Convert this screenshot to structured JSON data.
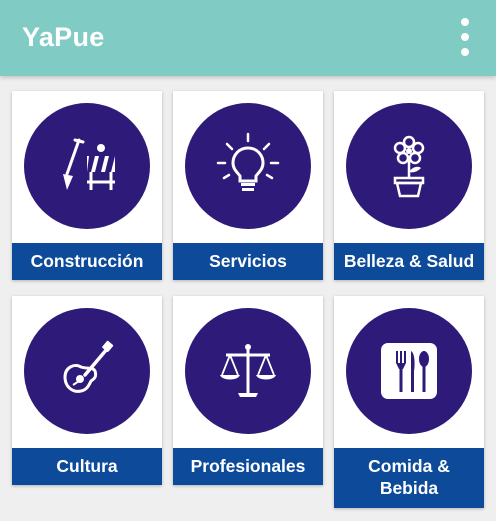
{
  "app_title": "YaPue",
  "menu_icon": "more-vertical-icon",
  "colors": {
    "appbar": "#80cbc4",
    "circle": "#2e1a78",
    "label_bar": "#0d4a9a",
    "background": "#efefef"
  },
  "categories": [
    {
      "label": "Construcción",
      "icon": "construction-icon"
    },
    {
      "label": "Servicios",
      "icon": "lightbulb-icon"
    },
    {
      "label": "Belleza & Salud",
      "icon": "flower-pot-icon"
    },
    {
      "label": "Cultura",
      "icon": "guitar-icon"
    },
    {
      "label": "Profesionales",
      "icon": "scales-icon"
    },
    {
      "label": "Comida &\nBebida",
      "icon": "cutlery-icon"
    }
  ]
}
